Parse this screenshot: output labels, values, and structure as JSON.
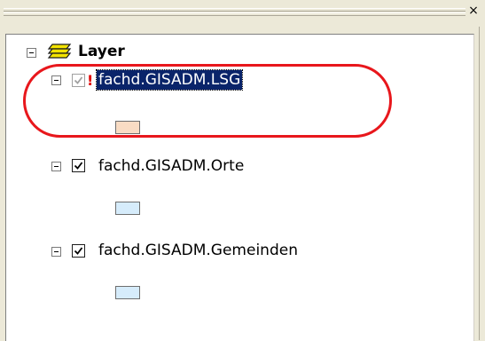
{
  "window": {
    "close_glyph": "×"
  },
  "toc": {
    "root": {
      "label": "Layer",
      "icon": "layers-icon"
    },
    "layers": [
      {
        "label": "fachd.GISADM.LSG",
        "checked": true,
        "disabled": true,
        "warning": "!",
        "selected": true,
        "symbol_color": "#f9dcc4"
      },
      {
        "label": "fachd.GISADM.Orte",
        "checked": true,
        "disabled": false,
        "selected": false,
        "symbol_color": "#d6ecfb"
      },
      {
        "label": "fachd.GISADM.Gemeinden",
        "checked": true,
        "disabled": false,
        "selected": false,
        "symbol_color": "#d6ecfb"
      }
    ]
  },
  "colors": {
    "annotation_ring": "#e8171c",
    "selection": "#0a246a"
  }
}
